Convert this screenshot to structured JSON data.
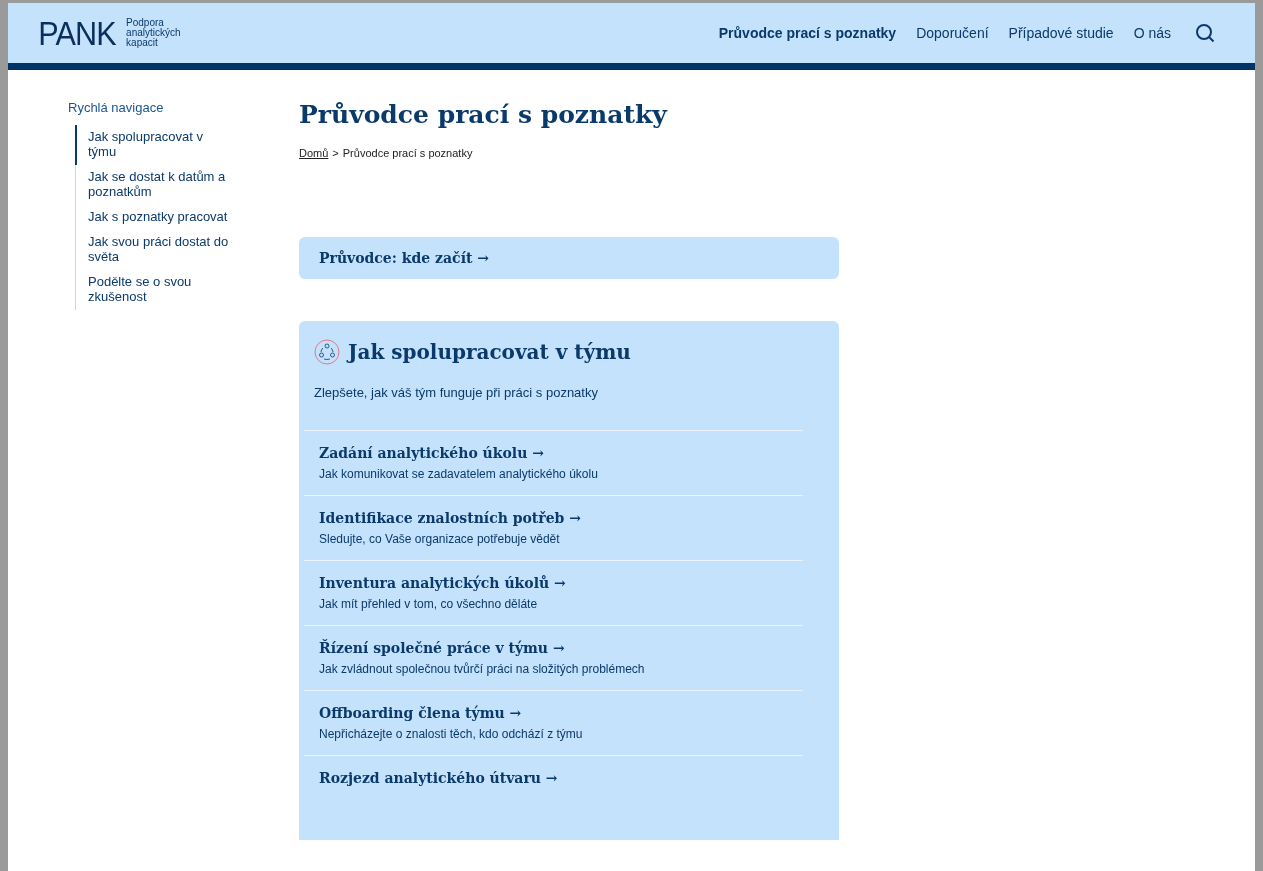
{
  "header": {
    "logo": "PANK",
    "tagline": [
      "Podpora",
      "analytických",
      "kapacit"
    ],
    "nav": [
      {
        "label": "Průvodce prací s poznatky",
        "selected": true
      },
      {
        "label": "Doporučení",
        "selected": false
      },
      {
        "label": "Případové studie",
        "selected": false
      },
      {
        "label": "O nás",
        "selected": false
      }
    ]
  },
  "sidebar": {
    "title": "Rychlá navigace",
    "items": [
      {
        "label": "Jak spolupracovat v týmu",
        "selected": true
      },
      {
        "label": "Jak se dostat k datům a poznatkům",
        "selected": false
      },
      {
        "label": "Jak s poznatky pracovat",
        "selected": false
      },
      {
        "label": "Jak svou práci dostat do světa",
        "selected": false
      },
      {
        "label": "Podělte se o svou zkušenost",
        "selected": false
      }
    ]
  },
  "page": {
    "title": "Průvodce prací s poznatky",
    "breadcrumb": {
      "home": "Domů",
      "separator": ">",
      "current": "Průvodce prací s poznatky"
    },
    "guide_link": "Průvodce: kde začít →"
  },
  "section": {
    "title": "Jak spolupracovat v týmu",
    "subtitle": "Zlepšete, jak váš tým funguje při práci s poznatky",
    "items": [
      {
        "title": "Zadání analytického úkolu →",
        "description": "Jak komunikovat se zadavatelem analytického úkolu"
      },
      {
        "title": "Identifikace znalostních potřeb →",
        "description": "Sledujte, co Vaše organizace potřebuje vědět"
      },
      {
        "title": "Inventura analytických úkolů →",
        "description": "Jak mít přehled v tom, co všechno děláte"
      },
      {
        "title": "Řízení společné práce v týmu →",
        "description": "Jak zvládnout společnou tvůrčí práci na složitých problémech"
      },
      {
        "title": "Offboarding člena týmu →",
        "description": "Nepřicházejte o znalosti těch, kdo odchází z týmu"
      },
      {
        "title": "Rozjezd analytického útvaru →"
      }
    ]
  }
}
